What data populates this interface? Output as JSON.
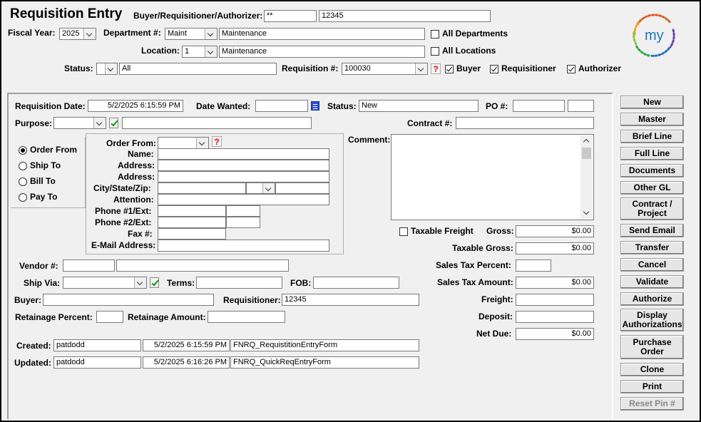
{
  "header": {
    "title": "Requisition Entry",
    "buyer_label": "Buyer/Requisitioner/Authorizer:",
    "buyer_code": "**",
    "buyer_value": "12345",
    "fiscal_year_label": "Fiscal Year:",
    "fiscal_year": "2025",
    "department_label": "Department #:",
    "department_code": "Maint",
    "department_name": "Maintenance",
    "all_departments_label": "All Departments",
    "location_label": "Location:",
    "location_code": "1",
    "location_name": "Maintenance",
    "all_locations_label": "All Locations",
    "status_label": "Status:",
    "status_code": "",
    "status_value": "All",
    "requisition_label": "Requisition #:",
    "requisition_value": "100030",
    "buyer_chk_label": "Buyer",
    "requisitioner_chk_label": "Requisitioner",
    "authorizer_chk_label": "Authorizer",
    "logo_text": "my"
  },
  "form": {
    "req_date_label": "Requisition Date:",
    "req_date": "5/2/2025 6:15:59 PM",
    "date_wanted_label": "Date Wanted:",
    "date_wanted": "",
    "status_label": "Status:",
    "status": "New",
    "po_label": "PO #:",
    "po_value": "",
    "po_suffix": "",
    "purpose_label": "Purpose:",
    "purpose_code": "",
    "purpose_desc": "",
    "contract_label": "Contract #:",
    "contract_value": "",
    "comment_label": "Comment:",
    "comment": "",
    "address_types": [
      "Order From",
      "Ship To",
      "Bill To",
      "Pay To"
    ],
    "address": {
      "order_from_label": "Order From:",
      "name_label": "Name:",
      "address1_label": "Address:",
      "address2_label": "Address:",
      "city_label": "City/State/Zip:",
      "attention_label": "Attention:",
      "phone1_label": "Phone #1/Ext:",
      "phone2_label": "Phone #2/Ext:",
      "fax_label": "Fax #:",
      "email_label": "E-Mail Address:"
    },
    "taxable_freight_label": "Taxable Freight",
    "gross_label": "Gross:",
    "gross": "$0.00",
    "taxable_gross_label": "Taxable Gross:",
    "taxable_gross": "$0.00",
    "sales_tax_pct_label": "Sales Tax Percent:",
    "sales_tax_pct": "",
    "sales_tax_amt_label": "Sales Tax Amount:",
    "sales_tax_amt": "$0.00",
    "freight_label": "Freight:",
    "freight": "",
    "deposit_label": "Deposit:",
    "deposit": "",
    "net_due_label": "Net Due:",
    "net_due": "$0.00",
    "vendor_label": "Vendor #:",
    "vendor_code": "",
    "vendor_name": "",
    "ship_via_label": "Ship Via:",
    "ship_via": "",
    "terms_label": "Terms:",
    "terms": "",
    "fob_label": "FOB:",
    "fob": "",
    "buyer_label": "Buyer:",
    "buyer": "",
    "requisitioner_label": "Requisitioner:",
    "requisitioner": "12345",
    "retainage_pct_label": "Retainage Percent:",
    "retainage_pct": "",
    "retainage_amt_label": "Retainage Amount:",
    "retainage_amt": "",
    "created_label": "Created:",
    "created_user": "patdodd",
    "created_date": "5/2/2025 6:15:59 PM",
    "created_form": "FNRQ_RequistitionEntryForm",
    "updated_label": "Updated:",
    "updated_user": "patdodd",
    "updated_date": "5/2/2025 6:16:26 PM",
    "updated_form": "FNRQ_QuickReqEntryForm"
  },
  "buttons": {
    "new": "New",
    "master": "Master",
    "brief_line": "Brief Line",
    "full_line": "Full Line",
    "documents": "Documents",
    "other_gl": "Other GL",
    "contract_project_1": "Contract /",
    "contract_project_2": "Project",
    "send_email": "Send Email",
    "transfer": "Transfer",
    "cancel": "Cancel",
    "validate": "Validate",
    "authorize": "Authorize",
    "display_auth_1": "Display",
    "display_auth_2": "Authorizations",
    "purchase_order_1": "Purchase",
    "purchase_order_2": "Order",
    "clone": "Clone",
    "print": "Print",
    "reset_pin": "Reset Pin #"
  },
  "colors": {
    "background": "#f0f0f0",
    "required_marker": "#e00000",
    "check_green": "#0a9a0a",
    "calendar_blue": "#2b4fd8"
  },
  "icons": {
    "help": "question-mark-icon",
    "validate": "green-check-icon",
    "calendar": "calendar-icon",
    "dropdown": "chevron-down-icon"
  }
}
